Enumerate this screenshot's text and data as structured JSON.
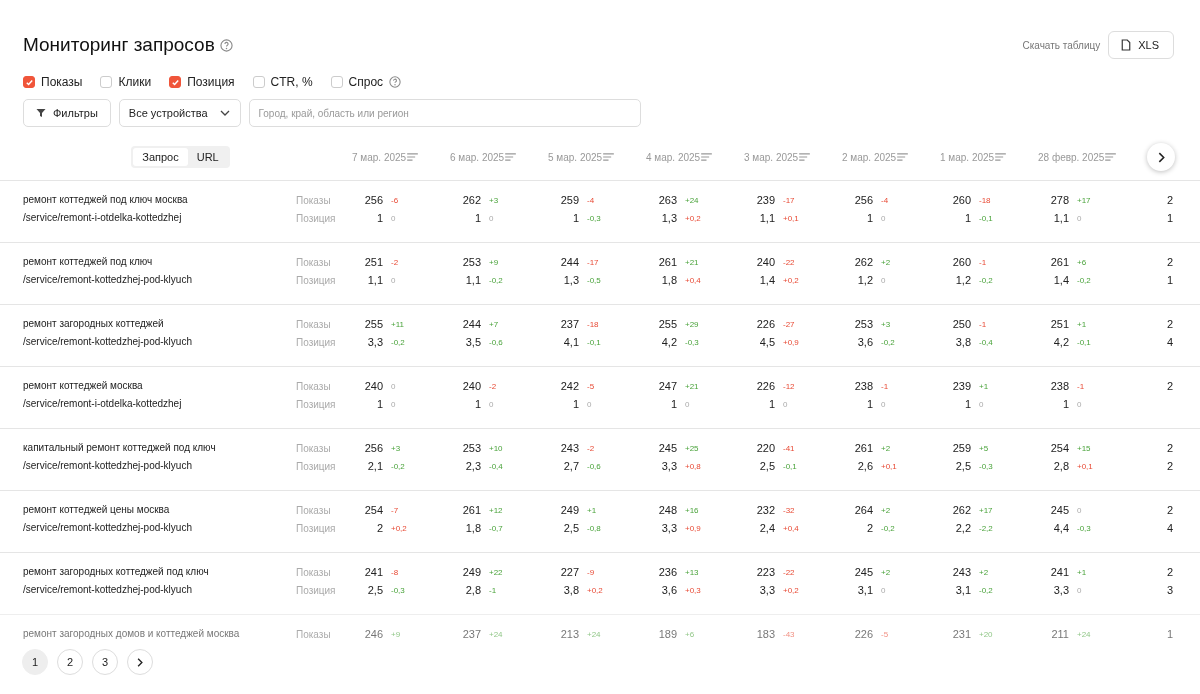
{
  "title": "Мониторинг запросов",
  "download_label": "Скачать таблицу",
  "xls_button": "XLS",
  "metrics": [
    {
      "label": "Показы",
      "checked": true,
      "help": false
    },
    {
      "label": "Клики",
      "checked": false,
      "help": false
    },
    {
      "label": "Позиция",
      "checked": true,
      "help": false
    },
    {
      "label": "CTR, %",
      "checked": false,
      "help": false
    },
    {
      "label": "Спрос",
      "checked": false,
      "help": true
    }
  ],
  "filters_button": "Фильтры",
  "device_select": "Все устройства",
  "region_field": {
    "placeholder": "Город, край, область или регион"
  },
  "view_tabs": [
    {
      "label": "Запрос",
      "selected": true
    },
    {
      "label": "URL",
      "selected": false
    }
  ],
  "dates": [
    "7 мар. 2025",
    "6 мар. 2025",
    "5 мар. 2025",
    "4 мар. 2025",
    "3 мар. 2025",
    "2 мар. 2025",
    "1 мар. 2025",
    "28 февр. 2025"
  ],
  "rows": [
    {
      "query": "ремонт коттеджей под ключ москва",
      "url": "/service/remont-i-otdelka-kottedzhej",
      "faded": false,
      "lines": [
        {
          "label": "Показы",
          "edge": "2",
          "cells": [
            {
              "value": "256",
              "delta": "-6",
              "kind": "bad"
            },
            {
              "value": "262",
              "delta": "+3",
              "kind": "good"
            },
            {
              "value": "259",
              "delta": "-4",
              "kind": "bad"
            },
            {
              "value": "263",
              "delta": "+24",
              "kind": "good"
            },
            {
              "value": "239",
              "delta": "-17",
              "kind": "bad"
            },
            {
              "value": "256",
              "delta": "-4",
              "kind": "bad"
            },
            {
              "value": "260",
              "delta": "-18",
              "kind": "bad"
            },
            {
              "value": "278",
              "delta": "+17",
              "kind": "good"
            }
          ]
        },
        {
          "label": "Позиция",
          "edge": "1",
          "cells": [
            {
              "value": "1",
              "delta": "0",
              "kind": "neutral"
            },
            {
              "value": "1",
              "delta": "0",
              "kind": "neutral"
            },
            {
              "value": "1",
              "delta": "-0,3",
              "kind": "good"
            },
            {
              "value": "1,3",
              "delta": "+0,2",
              "kind": "bad"
            },
            {
              "value": "1,1",
              "delta": "+0,1",
              "kind": "bad"
            },
            {
              "value": "1",
              "delta": "0",
              "kind": "neutral"
            },
            {
              "value": "1",
              "delta": "-0,1",
              "kind": "good"
            },
            {
              "value": "1,1",
              "delta": "0",
              "kind": "neutral"
            }
          ]
        }
      ]
    },
    {
      "query": "ремонт коттеджей под ключ",
      "url": "/service/remont-kottedzhej-pod-klyuch",
      "faded": false,
      "lines": [
        {
          "label": "Показы",
          "edge": "2",
          "cells": [
            {
              "value": "251",
              "delta": "-2",
              "kind": "bad"
            },
            {
              "value": "253",
              "delta": "+9",
              "kind": "good"
            },
            {
              "value": "244",
              "delta": "-17",
              "kind": "bad"
            },
            {
              "value": "261",
              "delta": "+21",
              "kind": "good"
            },
            {
              "value": "240",
              "delta": "-22",
              "kind": "bad"
            },
            {
              "value": "262",
              "delta": "+2",
              "kind": "good"
            },
            {
              "value": "260",
              "delta": "-1",
              "kind": "bad"
            },
            {
              "value": "261",
              "delta": "+6",
              "kind": "good"
            }
          ]
        },
        {
          "label": "Позиция",
          "edge": "1",
          "cells": [
            {
              "value": "1,1",
              "delta": "0",
              "kind": "neutral"
            },
            {
              "value": "1,1",
              "delta": "-0,2",
              "kind": "good"
            },
            {
              "value": "1,3",
              "delta": "-0,5",
              "kind": "good"
            },
            {
              "value": "1,8",
              "delta": "+0,4",
              "kind": "bad"
            },
            {
              "value": "1,4",
              "delta": "+0,2",
              "kind": "bad"
            },
            {
              "value": "1,2",
              "delta": "0",
              "kind": "neutral"
            },
            {
              "value": "1,2",
              "delta": "-0,2",
              "kind": "good"
            },
            {
              "value": "1,4",
              "delta": "-0,2",
              "kind": "good"
            }
          ]
        }
      ]
    },
    {
      "query": "ремонт загородных коттеджей",
      "url": "/service/remont-kottedzhej-pod-klyuch",
      "faded": false,
      "lines": [
        {
          "label": "Показы",
          "edge": "2",
          "cells": [
            {
              "value": "255",
              "delta": "+11",
              "kind": "good"
            },
            {
              "value": "244",
              "delta": "+7",
              "kind": "good"
            },
            {
              "value": "237",
              "delta": "-18",
              "kind": "bad"
            },
            {
              "value": "255",
              "delta": "+29",
              "kind": "good"
            },
            {
              "value": "226",
              "delta": "-27",
              "kind": "bad"
            },
            {
              "value": "253",
              "delta": "+3",
              "kind": "good"
            },
            {
              "value": "250",
              "delta": "-1",
              "kind": "bad"
            },
            {
              "value": "251",
              "delta": "+1",
              "kind": "good"
            }
          ]
        },
        {
          "label": "Позиция",
          "edge": "4",
          "cells": [
            {
              "value": "3,3",
              "delta": "-0,2",
              "kind": "good"
            },
            {
              "value": "3,5",
              "delta": "-0,6",
              "kind": "good"
            },
            {
              "value": "4,1",
              "delta": "-0,1",
              "kind": "good"
            },
            {
              "value": "4,2",
              "delta": "-0,3",
              "kind": "good"
            },
            {
              "value": "4,5",
              "delta": "+0,9",
              "kind": "bad"
            },
            {
              "value": "3,6",
              "delta": "-0,2",
              "kind": "good"
            },
            {
              "value": "3,8",
              "delta": "-0,4",
              "kind": "good"
            },
            {
              "value": "4,2",
              "delta": "-0,1",
              "kind": "good"
            }
          ]
        }
      ]
    },
    {
      "query": "ремонт коттеджей москва",
      "url": "/service/remont-i-otdelka-kottedzhej",
      "faded": false,
      "lines": [
        {
          "label": "Показы",
          "edge": "2",
          "cells": [
            {
              "value": "240",
              "delta": "0",
              "kind": "neutral"
            },
            {
              "value": "240",
              "delta": "-2",
              "kind": "bad"
            },
            {
              "value": "242",
              "delta": "-5",
              "kind": "bad"
            },
            {
              "value": "247",
              "delta": "+21",
              "kind": "good"
            },
            {
              "value": "226",
              "delta": "-12",
              "kind": "bad"
            },
            {
              "value": "238",
              "delta": "-1",
              "kind": "bad"
            },
            {
              "value": "239",
              "delta": "+1",
              "kind": "good"
            },
            {
              "value": "238",
              "delta": "-1",
              "kind": "bad"
            }
          ]
        },
        {
          "label": "Позиция",
          "cells": [
            {
              "value": "1",
              "delta": "0",
              "kind": "neutral"
            },
            {
              "value": "1",
              "delta": "0",
              "kind": "neutral"
            },
            {
              "value": "1",
              "delta": "0",
              "kind": "neutral"
            },
            {
              "value": "1",
              "delta": "0",
              "kind": "neutral"
            },
            {
              "value": "1",
              "delta": "0",
              "kind": "neutral"
            },
            {
              "value": "1",
              "delta": "0",
              "kind": "neutral"
            },
            {
              "value": "1",
              "delta": "0",
              "kind": "neutral"
            },
            {
              "value": "1",
              "delta": "0",
              "kind": "neutral"
            }
          ]
        }
      ]
    },
    {
      "query": "капитальный ремонт коттеджей под ключ",
      "url": "/service/remont-kottedzhej-pod-klyuch",
      "faded": false,
      "lines": [
        {
          "label": "Показы",
          "edge": "2",
          "cells": [
            {
              "value": "256",
              "delta": "+3",
              "kind": "good"
            },
            {
              "value": "253",
              "delta": "+10",
              "kind": "good"
            },
            {
              "value": "243",
              "delta": "-2",
              "kind": "bad"
            },
            {
              "value": "245",
              "delta": "+25",
              "kind": "good"
            },
            {
              "value": "220",
              "delta": "-41",
              "kind": "bad"
            },
            {
              "value": "261",
              "delta": "+2",
              "kind": "good"
            },
            {
              "value": "259",
              "delta": "+5",
              "kind": "good"
            },
            {
              "value": "254",
              "delta": "+15",
              "kind": "good"
            }
          ]
        },
        {
          "label": "Позиция",
          "edge": "2",
          "cells": [
            {
              "value": "2,1",
              "delta": "-0,2",
              "kind": "good"
            },
            {
              "value": "2,3",
              "delta": "-0,4",
              "kind": "good"
            },
            {
              "value": "2,7",
              "delta": "-0,6",
              "kind": "good"
            },
            {
              "value": "3,3",
              "delta": "+0,8",
              "kind": "bad"
            },
            {
              "value": "2,5",
              "delta": "-0,1",
              "kind": "good"
            },
            {
              "value": "2,6",
              "delta": "+0,1",
              "kind": "bad"
            },
            {
              "value": "2,5",
              "delta": "-0,3",
              "kind": "good"
            },
            {
              "value": "2,8",
              "delta": "+0,1",
              "kind": "bad"
            }
          ]
        }
      ]
    },
    {
      "query": "ремонт коттеджей цены москва",
      "url": "/service/remont-kottedzhej-pod-klyuch",
      "faded": false,
      "lines": [
        {
          "label": "Показы",
          "edge": "2",
          "cells": [
            {
              "value": "254",
              "delta": "-7",
              "kind": "bad"
            },
            {
              "value": "261",
              "delta": "+12",
              "kind": "good"
            },
            {
              "value": "249",
              "delta": "+1",
              "kind": "good"
            },
            {
              "value": "248",
              "delta": "+16",
              "kind": "good"
            },
            {
              "value": "232",
              "delta": "-32",
              "kind": "bad"
            },
            {
              "value": "264",
              "delta": "+2",
              "kind": "good"
            },
            {
              "value": "262",
              "delta": "+17",
              "kind": "good"
            },
            {
              "value": "245",
              "delta": "0",
              "kind": "neutral"
            }
          ]
        },
        {
          "label": "Позиция",
          "edge": "4",
          "cells": [
            {
              "value": "2",
              "delta": "+0,2",
              "kind": "bad"
            },
            {
              "value": "1,8",
              "delta": "-0,7",
              "kind": "good"
            },
            {
              "value": "2,5",
              "delta": "-0,8",
              "kind": "good"
            },
            {
              "value": "3,3",
              "delta": "+0,9",
              "kind": "bad"
            },
            {
              "value": "2,4",
              "delta": "+0,4",
              "kind": "bad"
            },
            {
              "value": "2",
              "delta": "-0,2",
              "kind": "good"
            },
            {
              "value": "2,2",
              "delta": "-2,2",
              "kind": "good"
            },
            {
              "value": "4,4",
              "delta": "-0,3",
              "kind": "good"
            }
          ]
        }
      ]
    },
    {
      "query": "ремонт загородных коттеджей под ключ",
      "url": "/service/remont-kottedzhej-pod-klyuch",
      "faded": false,
      "lines": [
        {
          "label": "Показы",
          "edge": "2",
          "cells": [
            {
              "value": "241",
              "delta": "-8",
              "kind": "bad"
            },
            {
              "value": "249",
              "delta": "+22",
              "kind": "good"
            },
            {
              "value": "227",
              "delta": "-9",
              "kind": "bad"
            },
            {
              "value": "236",
              "delta": "+13",
              "kind": "good"
            },
            {
              "value": "223",
              "delta": "-22",
              "kind": "bad"
            },
            {
              "value": "245",
              "delta": "+2",
              "kind": "good"
            },
            {
              "value": "243",
              "delta": "+2",
              "kind": "good"
            },
            {
              "value": "241",
              "delta": "+1",
              "kind": "good"
            }
          ]
        },
        {
          "label": "Позиция",
          "edge": "3",
          "cells": [
            {
              "value": "2,5",
              "delta": "-0,3",
              "kind": "good"
            },
            {
              "value": "2,8",
              "delta": "-1",
              "kind": "good"
            },
            {
              "value": "3,8",
              "delta": "+0,2",
              "kind": "bad"
            },
            {
              "value": "3,6",
              "delta": "+0,3",
              "kind": "bad"
            },
            {
              "value": "3,3",
              "delta": "+0,2",
              "kind": "bad"
            },
            {
              "value": "3,1",
              "delta": "0",
              "kind": "neutral"
            },
            {
              "value": "3,1",
              "delta": "-0,2",
              "kind": "good"
            },
            {
              "value": "3,3",
              "delta": "0",
              "kind": "neutral"
            }
          ]
        }
      ]
    },
    {
      "query": "ремонт загородных домов и коттеджей москва",
      "faded": true,
      "lines": [
        {
          "label": "Показы",
          "edge": "1",
          "cells": [
            {
              "value": "246",
              "delta": "+9",
              "kind": "good"
            },
            {
              "value": "237",
              "delta": "+24",
              "kind": "good"
            },
            {
              "value": "213",
              "delta": "+24",
              "kind": "good"
            },
            {
              "value": "189",
              "delta": "+6",
              "kind": "good"
            },
            {
              "value": "183",
              "delta": "-43",
              "kind": "bad"
            },
            {
              "value": "226",
              "delta": "-5",
              "kind": "bad"
            },
            {
              "value": "231",
              "delta": "+20",
              "kind": "good"
            },
            {
              "value": "211",
              "delta": "+24",
              "kind": "good"
            }
          ]
        }
      ]
    }
  ],
  "pages": [
    {
      "label": "1",
      "selected": true
    },
    {
      "label": "2",
      "selected": false
    },
    {
      "label": "3",
      "selected": false
    }
  ]
}
